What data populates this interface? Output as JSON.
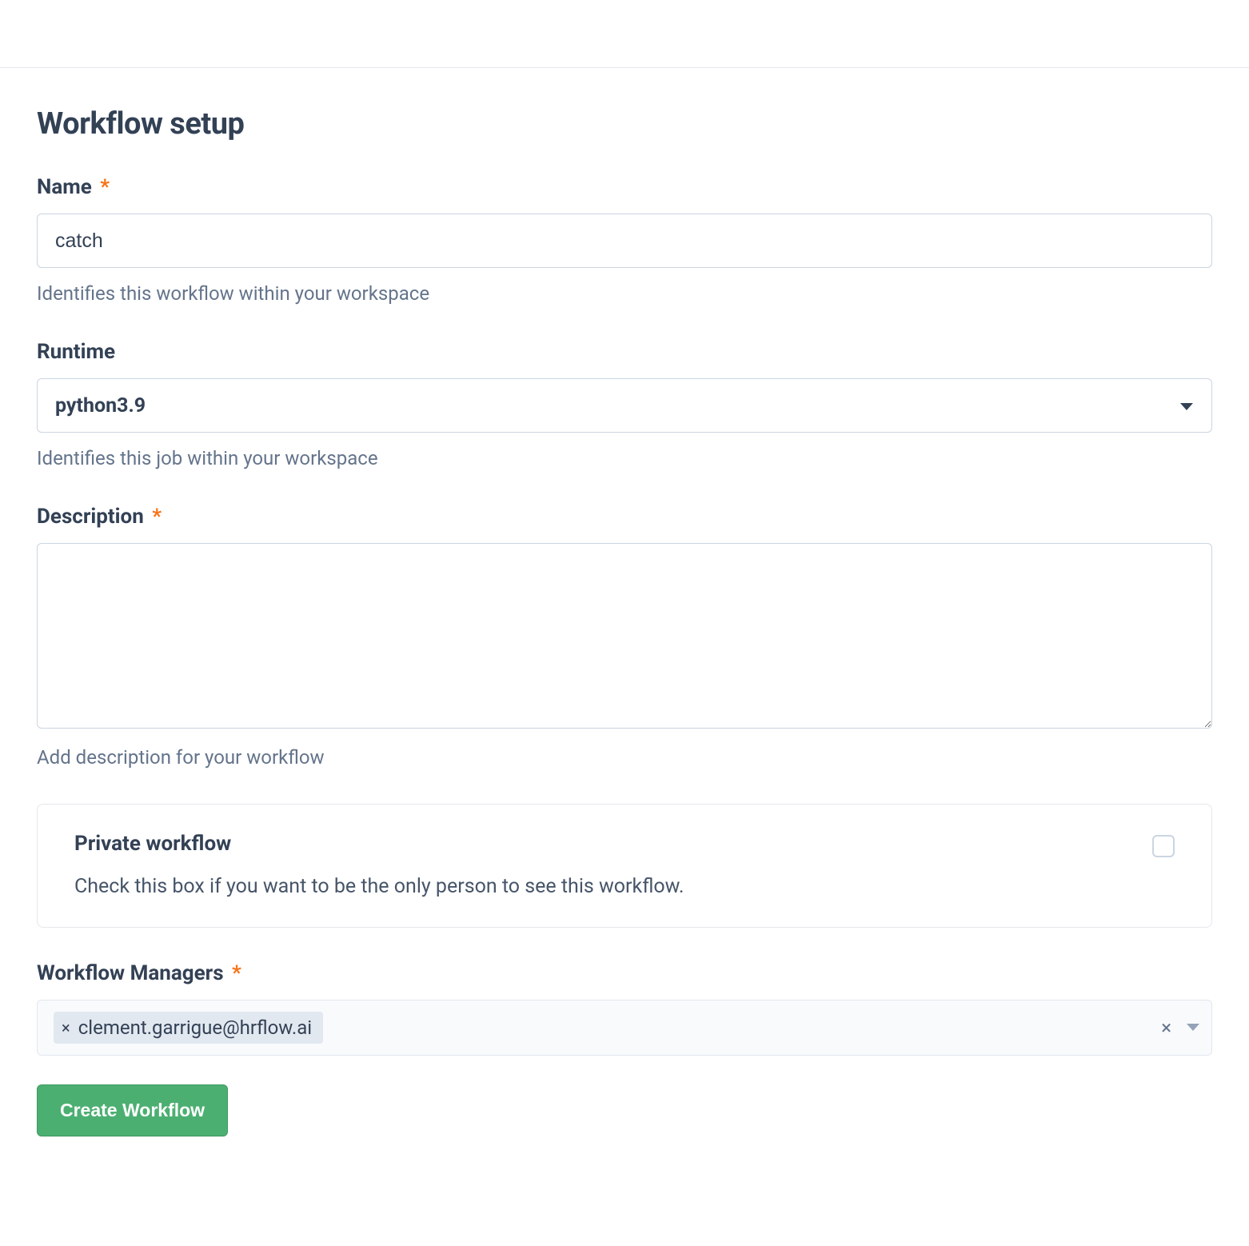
{
  "title": "Workflow setup",
  "name": {
    "label": "Name",
    "value": "catch",
    "helper": "Identifies this workflow within your workspace",
    "required": true
  },
  "runtime": {
    "label": "Runtime",
    "value": "python3.9",
    "helper": "Identifies this job within your workspace"
  },
  "description": {
    "label": "Description",
    "value": "",
    "helper": "Add description for your workflow",
    "required": true
  },
  "private": {
    "title": "Private workflow",
    "desc": "Check this box if you want to be the only person to see this workflow.",
    "checked": false
  },
  "managers": {
    "label": "Workflow Managers",
    "required": true,
    "chips": [
      {
        "remove_icon": "×",
        "text": "clement.garrigue@hrflow.ai"
      }
    ],
    "clear_icon": "×"
  },
  "buttons": {
    "create": "Create Workflow"
  },
  "required_mark": "*"
}
